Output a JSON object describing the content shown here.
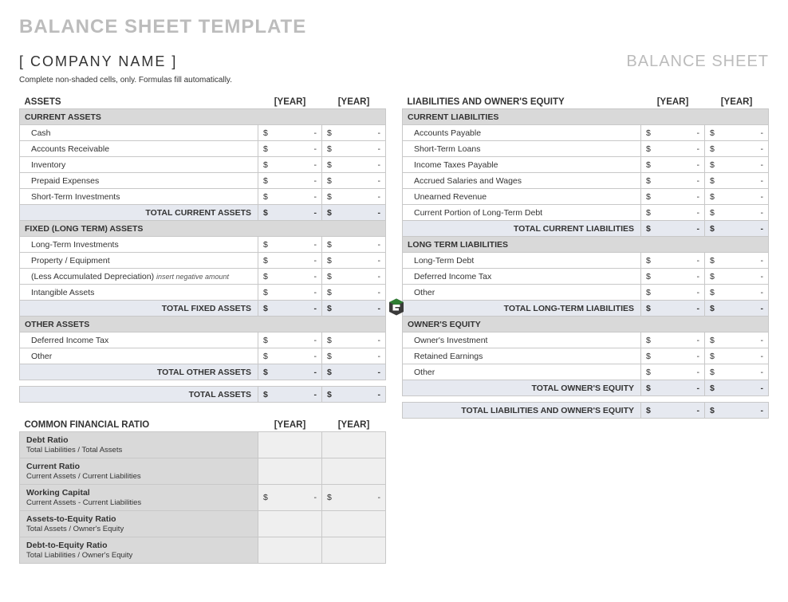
{
  "page_title": "BALANCE SHEET TEMPLATE",
  "company_name": "[ COMPANY NAME ]",
  "doc_label": "BALANCE SHEET",
  "instruction": "Complete non-shaded cells, only.  Formulas fill automatically.",
  "year_placeholder": "[YEAR]",
  "dash": "-",
  "dollar": "$",
  "assets": {
    "title": "ASSETS",
    "current": {
      "header": "CURRENT ASSETS",
      "rows": [
        "Cash",
        "Accounts Receivable",
        "Inventory",
        "Prepaid Expenses",
        "Short-Term Investments"
      ],
      "total": "TOTAL CURRENT ASSETS"
    },
    "fixed": {
      "header": "FIXED (LONG TERM) ASSETS",
      "rows": [
        "Long-Term Investments",
        "Property / Equipment",
        "(Less Accumulated Depreciation)",
        "Intangible Assets"
      ],
      "note": "insert negative amount",
      "total": "TOTAL FIXED ASSETS"
    },
    "other": {
      "header": "OTHER ASSETS",
      "rows": [
        "Deferred Income Tax",
        "Other"
      ],
      "total": "TOTAL OTHER ASSETS"
    },
    "grand_total": "TOTAL ASSETS"
  },
  "liabilities": {
    "title": "LIABILITIES AND OWNER'S EQUITY",
    "current": {
      "header": "CURRENT LIABILITIES",
      "rows": [
        "Accounts Payable",
        "Short-Term Loans",
        "Income Taxes Payable",
        "Accrued Salaries and Wages",
        "Unearned Revenue",
        "Current Portion of Long-Term Debt"
      ],
      "total": "TOTAL CURRENT LIABILITIES"
    },
    "longterm": {
      "header": "LONG TERM LIABILITIES",
      "rows": [
        "Long-Term Debt",
        "Deferred Income Tax",
        "Other"
      ],
      "total": "TOTAL LONG-TERM LIABILITIES"
    },
    "equity": {
      "header": "OWNER'S EQUITY",
      "rows": [
        "Owner's Investment",
        "Retained Earnings",
        "Other"
      ],
      "total": "TOTAL OWNER'S EQUITY"
    },
    "grand_total": "TOTAL LIABILITIES AND OWNER'S EQUITY"
  },
  "ratios": {
    "title": "COMMON FINANCIAL RATIO",
    "items": [
      {
        "name": "Debt Ratio",
        "desc": "Total Liabilities / Total Assets",
        "money": false
      },
      {
        "name": "Current Ratio",
        "desc": "Current Assets / Current Liabilities",
        "money": false
      },
      {
        "name": "Working Capital",
        "desc": "Current Assets - Current Liabilities",
        "money": true
      },
      {
        "name": "Assets-to-Equity Ratio",
        "desc": "Total Assets / Owner's Equity",
        "money": false
      },
      {
        "name": "Debt-to-Equity Ratio",
        "desc": "Total Liabilities / Owner's Equity",
        "money": false
      }
    ]
  }
}
